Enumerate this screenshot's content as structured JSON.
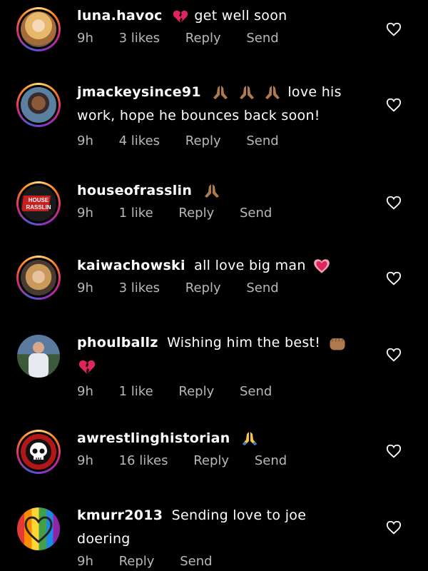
{
  "comments": [
    {
      "username": "luna.havoc",
      "text": "get well soon",
      "time": "9h",
      "likes": "3 likes",
      "reply": "Reply",
      "send": "Send",
      "avatar": "portrait-blonde",
      "story": true
    },
    {
      "username": "jmackeysince91",
      "text": "love his work, hope he bounces back soon!",
      "time": "9h",
      "likes": "4 likes",
      "reply": "Reply",
      "send": "Send",
      "avatar": "portrait-man",
      "story": true
    },
    {
      "username": "houseofrasslin",
      "text": "",
      "time": "9h",
      "likes": "1 like",
      "reply": "Reply",
      "send": "Send",
      "avatar": "logo-house-of-rasslin",
      "story": true,
      "logo_text": "HOUSE OF RASSLIN"
    },
    {
      "username": "kaiwachowski",
      "text": "all love big man",
      "time": "9h",
      "likes": "3 likes",
      "reply": "Reply",
      "send": "Send",
      "avatar": "portrait-woman",
      "story": true
    },
    {
      "username": "phoulballz",
      "text": "Wishing him the best!",
      "time": "9h",
      "likes": "1 like",
      "reply": "Reply",
      "send": "Send",
      "avatar": "portrait-stadium",
      "story": false
    },
    {
      "username": "awrestlinghistorian",
      "text": "",
      "time": "9h",
      "likes": "16 likes",
      "reply": "Reply",
      "send": "Send",
      "avatar": "skull-logo",
      "story": true
    },
    {
      "username": "kmurr2013",
      "text": "Sending love to joe doering",
      "time": "9h",
      "likes": "",
      "reply": "Reply",
      "send": "Send",
      "avatar": "rainbow-heart",
      "story": false
    }
  ],
  "colors": {
    "background": "#000000",
    "meta": "#b8b8b8",
    "heart_emoji": "#e0245e",
    "story_ring": "#d62976"
  },
  "icons": {
    "like": "heart-outline-icon",
    "pray": "folded-hands-emoji",
    "heart": "heart-emoji",
    "fist": "fist-emoji"
  }
}
